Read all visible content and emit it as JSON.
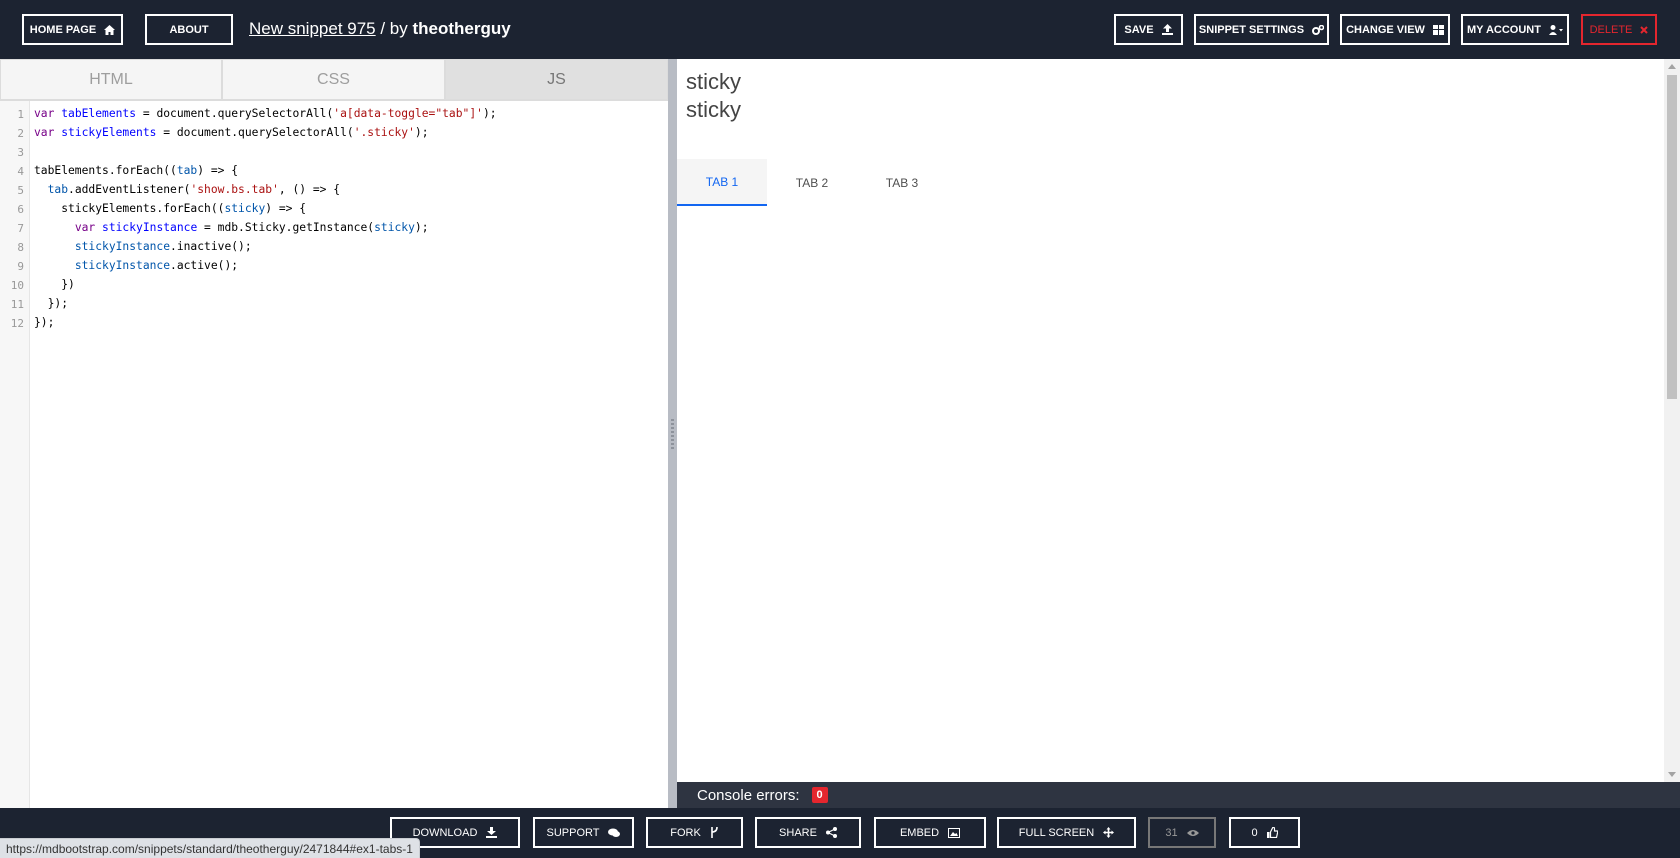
{
  "header": {
    "home_label": "HOME PAGE",
    "about_label": "ABOUT",
    "snippet_name": "New snippet 975",
    "by_text": " / by ",
    "author": "theotherguy",
    "save_label": "SAVE",
    "settings_label": "SNIPPET SETTINGS",
    "change_view_label": "CHANGE VIEW",
    "account_label": "MY ACCOUNT",
    "delete_label": "DELETE"
  },
  "editor": {
    "tabs": [
      {
        "label": "HTML"
      },
      {
        "label": "CSS"
      },
      {
        "label": "JS",
        "active": true
      }
    ],
    "line_numbers": [
      "1",
      "2",
      "3",
      "4",
      "5",
      "6",
      "7",
      "8",
      "9",
      "10",
      "11",
      "12"
    ]
  },
  "preview": {
    "sticky_lines": [
      "sticky",
      "sticky"
    ],
    "tabs": [
      {
        "label": "TAB 1",
        "active": true
      },
      {
        "label": "TAB 2"
      },
      {
        "label": "TAB 3"
      }
    ]
  },
  "console": {
    "label": "Console errors:",
    "count": "0"
  },
  "footer": {
    "download_label": "DOWNLOAD",
    "support_label": "SUPPORT",
    "fork_label": "FORK",
    "share_label": "SHARE",
    "embed_label": "EMBED",
    "fullscreen_label": "FULL SCREEN",
    "views_count": "31",
    "likes_count": "0",
    "status_url": "https://mdbootstrap.com/snippets/standard/theotherguy/2471844#ex1-tabs-1"
  },
  "colors": {
    "bar_bg": "#1c2331",
    "delete": "#e4262e",
    "tab_active": "#1266f1"
  },
  "icons": [
    "home-icon",
    "upload-icon",
    "cogs-icon",
    "view-icon",
    "user-icon",
    "close-icon",
    "download-icon",
    "comments-icon",
    "fork-icon",
    "share-icon",
    "image-icon",
    "move-icon",
    "eye-icon",
    "thumbs-up-icon"
  ]
}
